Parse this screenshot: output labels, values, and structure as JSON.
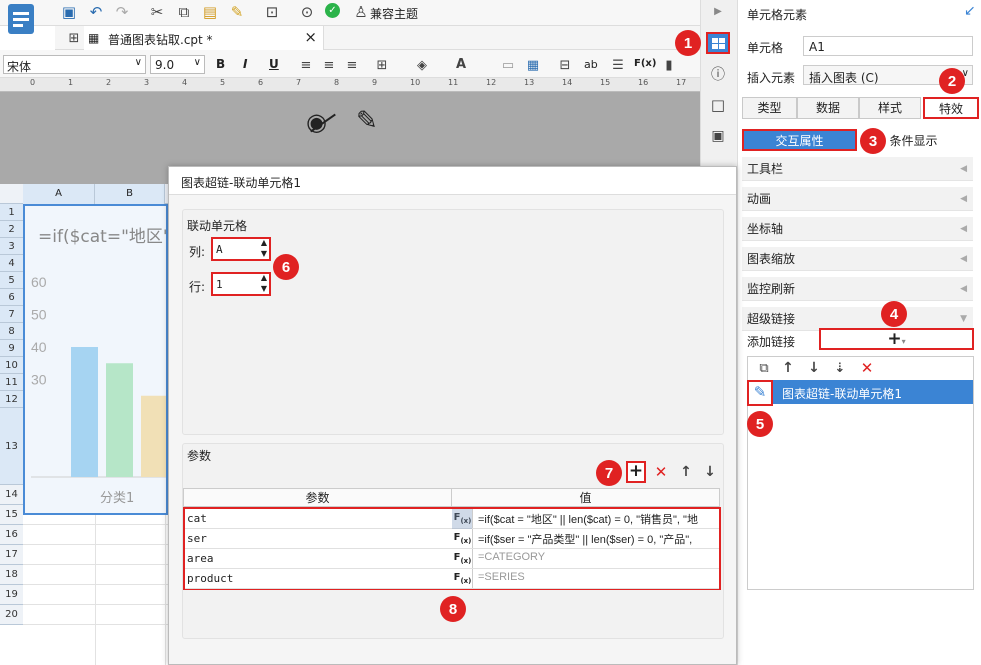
{
  "toolbar": {
    "theme_label": "兼容主题"
  },
  "file_tab": {
    "name": "普通图表钻取.cpt *",
    "close": "×"
  },
  "format": {
    "font": "宋体",
    "size": "9.0",
    "bold": "B",
    "italic": "I",
    "underline": "U",
    "abc": "ab",
    "fx": "F(x)"
  },
  "ruler": {
    "ticks": [
      "0",
      "1",
      "2",
      "3",
      "4",
      "5",
      "6",
      "7",
      "8",
      "9",
      "10",
      "11",
      "12",
      "13",
      "14",
      "15",
      "16",
      "17"
    ]
  },
  "sheet": {
    "columns": [
      "A",
      "B"
    ],
    "rows": [
      "1",
      "2",
      "3",
      "4",
      "5",
      "6",
      "7",
      "8",
      "9",
      "10",
      "11",
      "12",
      "13",
      "14",
      "15",
      "16",
      "17",
      "18",
      "19",
      "20"
    ]
  },
  "chart": {
    "formula": "=if($cat=\"地区\"",
    "yticks": [
      "60",
      "50",
      "40",
      "30"
    ],
    "category": "分类1",
    "chart_data": {
      "type": "bar",
      "categories": [
        "分类1"
      ],
      "series": [
        {
          "values": [
            40
          ]
        },
        {
          "values": [
            35
          ]
        },
        {
          "values": [
            25
          ]
        }
      ],
      "colors": [
        "#a6d4f2",
        "#b6e6c8",
        "#f1e0b6"
      ]
    }
  },
  "dialog": {
    "title": "图表超链-联动单元格1",
    "linked_cell_label": "联动单元格",
    "col_label": "列:",
    "col_value": "A",
    "row_label": "行:",
    "row_value": "1",
    "params_label": "参数",
    "table_headers": [
      "参数",
      "值"
    ],
    "params": [
      {
        "name": "cat",
        "value": "=if($cat = \"地区\" || len($cat) = 0, \"销售员\", \"地"
      },
      {
        "name": "ser",
        "value": "=if($ser = \"产品类型\" || len($ser) = 0, \"产品\","
      },
      {
        "name": "area",
        "value": "=CATEGORY"
      },
      {
        "name": "product",
        "value": "=SERIES"
      }
    ]
  },
  "right": {
    "title": "单元格元素",
    "cell_label": "单元格",
    "cell_value": "A1",
    "insert_label": "插入元素",
    "insert_value": "插入图表 (C)",
    "tabs": [
      "类型",
      "数据",
      "样式",
      "特效"
    ],
    "subtabs": [
      "交互属性",
      "条件显示"
    ],
    "sections": [
      "工具栏",
      "动画",
      "坐标轴",
      "图表缩放",
      "监控刷新",
      "超级链接"
    ],
    "add_link_label": "添加链接",
    "add_link_icon": "+",
    "link_item": "图表超链-联动单元格1"
  },
  "badges": [
    "1",
    "2",
    "3",
    "4",
    "5",
    "6",
    "7",
    "8"
  ]
}
